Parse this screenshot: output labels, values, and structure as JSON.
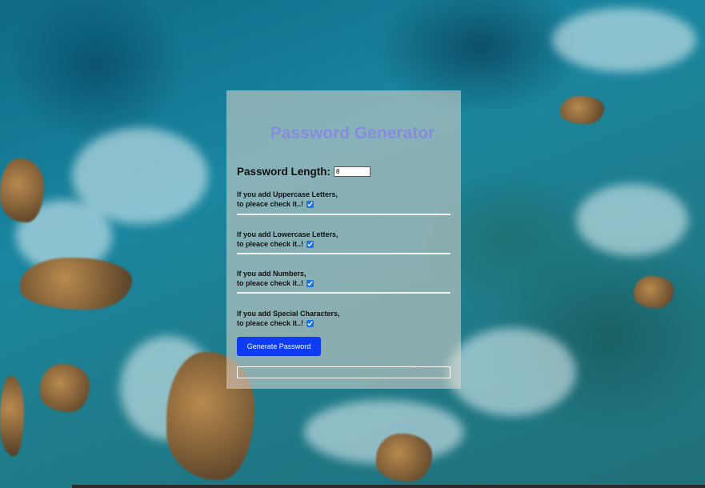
{
  "app": {
    "title": "Password Generator"
  },
  "form": {
    "length_label": "Password Length:",
    "length_value": "8",
    "options": [
      {
        "line1": "If you add Uppercase Letters,",
        "line2": "to pleace check it..!",
        "checked": true
      },
      {
        "line1": "If you add Lowercase Letters,",
        "line2": "to pleace check it..!",
        "checked": true
      },
      {
        "line1": "If you add Numbers,",
        "line2": "to pleace check it..!",
        "checked": true
      },
      {
        "line1": "If you add Special Characters,",
        "line2": "to pleace check it..!",
        "checked": true
      }
    ],
    "generate_label": "Generate Password",
    "output_value": ""
  },
  "colors": {
    "title": "#1733f0",
    "button": "#0f3cf2",
    "checkbox": "#1a73e8"
  },
  "icons": {
    "background": "ocean-rocks-background"
  }
}
